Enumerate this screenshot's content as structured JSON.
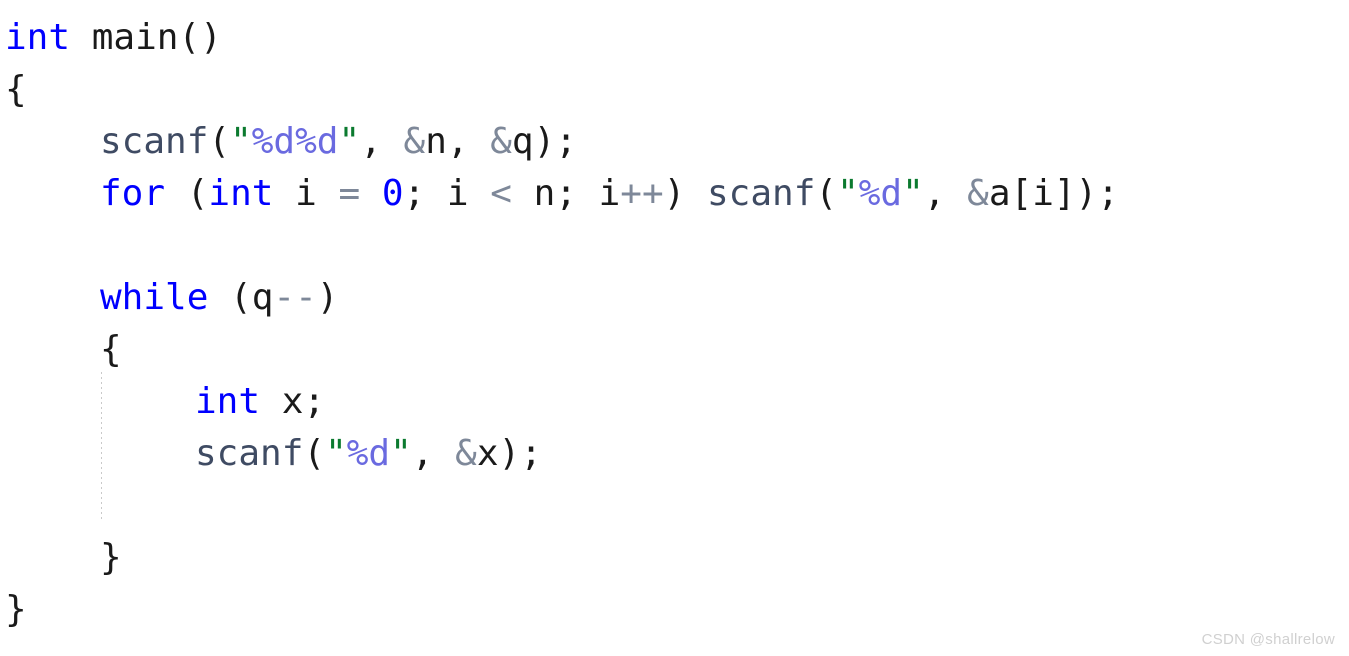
{
  "editor": {
    "language": "C",
    "background_color": "#ffffff",
    "font_size_px": 36,
    "line_height_px": 52,
    "theme_colors": {
      "keyword": "#0000ff",
      "identifier": "#1a1a1a",
      "function": "#3f4b63",
      "string_quote": "#0b7a2f",
      "format_specifier": "#6a6ae0",
      "operator": "#7e8899",
      "number": "#0000ff",
      "indent_guide": "#c9c9c9",
      "watermark": "#d0d0d0"
    }
  },
  "code": {
    "full_text": "int main()\n{\n    scanf(\"%d%d\", &n, &q);\n    for (int i = 0; i < n; i++) scanf(\"%d\", &a[i]);\n\n    while (q--)\n    {\n        int x;\n        scanf(\"%d\", &x);\n\n    }\n}",
    "lines": [
      {
        "index": 1,
        "indent": 0,
        "text": "int main()",
        "tokens": [
          {
            "t": "int",
            "c": "keyword"
          },
          {
            "t": " ",
            "c": "plain"
          },
          {
            "t": "main()",
            "c": "plain"
          }
        ]
      },
      {
        "index": 2,
        "indent": 0,
        "text": "{",
        "tokens": [
          {
            "t": "{",
            "c": "plain"
          }
        ]
      },
      {
        "index": 3,
        "indent": 1,
        "text": "    scanf(\"%d%d\", &n, &q);",
        "tokens": [
          {
            "t": "scanf",
            "c": "function"
          },
          {
            "t": "(",
            "c": "plain"
          },
          {
            "t": "\"",
            "c": "string_quote"
          },
          {
            "t": "%d%d",
            "c": "format_specifier"
          },
          {
            "t": "\"",
            "c": "string_quote"
          },
          {
            "t": ", ",
            "c": "plain"
          },
          {
            "t": "&",
            "c": "operator"
          },
          {
            "t": "n",
            "c": "plain"
          },
          {
            "t": ", ",
            "c": "plain"
          },
          {
            "t": "&",
            "c": "operator"
          },
          {
            "t": "q);",
            "c": "plain"
          }
        ]
      },
      {
        "index": 4,
        "indent": 1,
        "text": "    for (int i = 0; i < n; i++) scanf(\"%d\", &a[i]);",
        "tokens": [
          {
            "t": "for",
            "c": "keyword"
          },
          {
            "t": " (",
            "c": "plain"
          },
          {
            "t": "int",
            "c": "keyword"
          },
          {
            "t": " i ",
            "c": "plain"
          },
          {
            "t": "=",
            "c": "operator"
          },
          {
            "t": " ",
            "c": "plain"
          },
          {
            "t": "0",
            "c": "number"
          },
          {
            "t": "; i ",
            "c": "plain"
          },
          {
            "t": "<",
            "c": "operator"
          },
          {
            "t": " n; i",
            "c": "plain"
          },
          {
            "t": "++",
            "c": "operator"
          },
          {
            "t": ") ",
            "c": "plain"
          },
          {
            "t": "scanf",
            "c": "function"
          },
          {
            "t": "(",
            "c": "plain"
          },
          {
            "t": "\"",
            "c": "string_quote"
          },
          {
            "t": "%d",
            "c": "format_specifier"
          },
          {
            "t": "\"",
            "c": "string_quote"
          },
          {
            "t": ", ",
            "c": "plain"
          },
          {
            "t": "&",
            "c": "operator"
          },
          {
            "t": "a[i]);",
            "c": "plain"
          }
        ]
      },
      {
        "index": 5,
        "indent": 0,
        "text": "",
        "tokens": []
      },
      {
        "index": 6,
        "indent": 1,
        "text": "    while (q--)",
        "tokens": [
          {
            "t": "while",
            "c": "keyword"
          },
          {
            "t": " (q",
            "c": "plain"
          },
          {
            "t": "--",
            "c": "operator"
          },
          {
            "t": ")",
            "c": "plain"
          }
        ]
      },
      {
        "index": 7,
        "indent": 1,
        "text": "    {",
        "tokens": [
          {
            "t": "{",
            "c": "plain"
          }
        ]
      },
      {
        "index": 8,
        "indent": 2,
        "text": "        int x;",
        "tokens": [
          {
            "t": "int",
            "c": "keyword"
          },
          {
            "t": " x;",
            "c": "plain"
          }
        ]
      },
      {
        "index": 9,
        "indent": 2,
        "text": "        scanf(\"%d\", &x);",
        "tokens": [
          {
            "t": "scanf",
            "c": "function"
          },
          {
            "t": "(",
            "c": "plain"
          },
          {
            "t": "\"",
            "c": "string_quote"
          },
          {
            "t": "%d",
            "c": "format_specifier"
          },
          {
            "t": "\"",
            "c": "string_quote"
          },
          {
            "t": ", ",
            "c": "plain"
          },
          {
            "t": "&",
            "c": "operator"
          },
          {
            "t": "x);",
            "c": "plain"
          }
        ]
      },
      {
        "index": 10,
        "indent": 0,
        "text": "",
        "tokens": []
      },
      {
        "index": 11,
        "indent": 1,
        "text": "    }",
        "tokens": [
          {
            "t": "}",
            "c": "plain"
          }
        ]
      },
      {
        "index": 12,
        "indent": 0,
        "text": "}",
        "tokens": [
          {
            "t": "}",
            "c": "plain"
          }
        ]
      }
    ]
  },
  "watermark": {
    "text": "CSDN @shallrelow"
  }
}
